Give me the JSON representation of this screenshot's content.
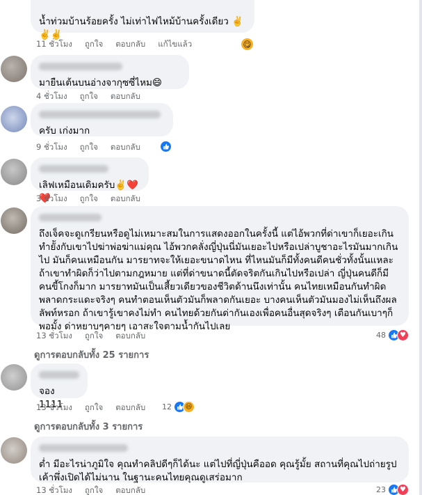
{
  "actions": {
    "like": "ถูกใจ",
    "reply": "ตอบกลับ",
    "edited": "แก้ไขแล้ว"
  },
  "comments": [
    {
      "text": "น้ำท่วมบ้านร้อยครั้ง ไม่เท่าไฟไหม้บ้านครั้งเดียว ✌️✌️✌️",
      "time": "11 ชั่วโมง",
      "reaction_icon": "yummy-emoji-icon"
    },
    {
      "text": "มายืนเต้นบนอ่างจากุซซี่ไหม😄",
      "time": "4 ชั่วโมง"
    },
    {
      "text": "ครับ เก่งมาก",
      "time": "9 ชั่วโมง",
      "reaction_icon": "like-icon"
    },
    {
      "text": "เลิฟเหมือนเดิมครับ✌️❤️❤️",
      "time": "3 ชั่วโมง"
    },
    {
      "text": "ถึงเจ็คจะดูเกรียนหรือดูไม่เหมาะสมในการแสดงออกในครั้งนี้ แต่ไอ้พวกที่ด่าเขาก็เยอะเกิน ทำยัังกับเขาไปฆ่าพ่อฆ่าแม่คุณ ไอ้พวกคลั่งญี่ปุ่นนี่มันเยอะไปหรือเปล่าบูชาอะไรมันมากเกินไป มันก็คนเหมือนกัน มารยาทจะให้เยอะขนาดไหน ที่ไหนมันก็มีทั้งคนดีคนชั่วทั้งนั้นแหละ ถ้าเขาทำผิดก็ว่าไปตามกฎหมาย แต่ที่ด่าขนาดนี้ตัดจริตกันเกินไปหรือเปล่า ญี่ปุ่นคนดีก็มี คนขี้โกงก็มาก มารยาทมันเป็นเสี้ยวเดียวของชีวิตด้านนึงเท่านั้น คนไทยเหมือนกันทำผิดพลาดกระแดะจริงๆ คนทำตอนเห็นตัวมันก็พลาดกันเยอะ บางคนเห็นตัวมันมองไม่เห็นถึงผลลัพท์หรอก ถ้าเขารู้เขาคงไม่ทำ คนไทยด้วยกันด่ากันเองเพื่อคนอื่นสุดจริงๆ เตือนกันเบาๆก็พอมั้ง ด่าหยาบๆคายๆ เอาสะใจตามน้ำกันไปเลย",
      "time": "13 ชั่วโมง",
      "reaction_count": "48",
      "replies": "ดูการตอบกลับทั้ง 25 รายการ"
    },
    {
      "text": "จอง 1111",
      "time": "13 ชั่วโมง",
      "reaction_count": "12",
      "replies": "ดูการตอบกลับทั้ง 3 รายการ"
    },
    {
      "text": "ต่ำ มีอะไรน่าภูมิใจ คุณทำคลิปดีๆก็ได้นะ แต่ไปที่ญี่ปุ่นคืออด คุณรู้มั้ย สถานที่คุณไปถ่ายรูป เค้าพึ่งเปิดได้ไม่นาน ในฐานะคนไทยคุณดูเสร่อมาก",
      "time": "13 ชั่วโมง",
      "reaction_count": "23"
    }
  ]
}
